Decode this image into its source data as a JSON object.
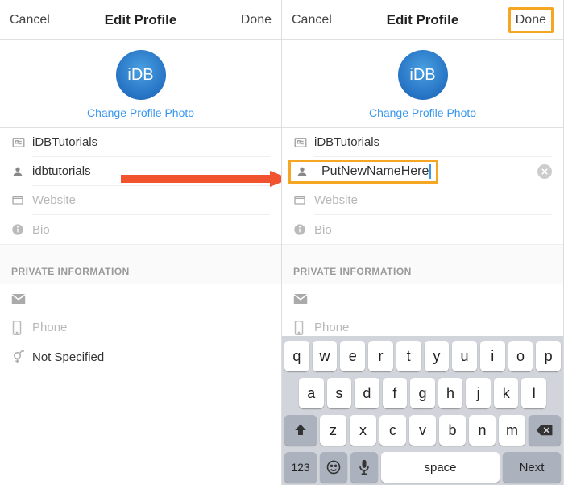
{
  "header": {
    "cancel": "Cancel",
    "title": "Edit Profile",
    "done": "Done"
  },
  "photo": {
    "avatar_text": "iDB",
    "change_label": "Change Profile Photo"
  },
  "left": {
    "name": "iDBTutorials",
    "username": "idbtutorials",
    "website_ph": "Website",
    "bio_ph": "Bio",
    "phone_ph": "Phone",
    "gender": "Not Specified"
  },
  "right": {
    "name": "iDBTutorials",
    "username": "PutNewNameHere",
    "website_ph": "Website",
    "bio_ph": "Bio",
    "phone_ph": "Phone"
  },
  "section_private": "PRIVATE INFORMATION",
  "keyboard": {
    "r1": [
      "q",
      "w",
      "e",
      "r",
      "t",
      "y",
      "u",
      "i",
      "o",
      "p"
    ],
    "r2": [
      "a",
      "s",
      "d",
      "f",
      "g",
      "h",
      "j",
      "k",
      "l"
    ],
    "r3": [
      "z",
      "x",
      "c",
      "v",
      "b",
      "n",
      "m"
    ],
    "num": "123",
    "space": "space",
    "next": "Next"
  }
}
